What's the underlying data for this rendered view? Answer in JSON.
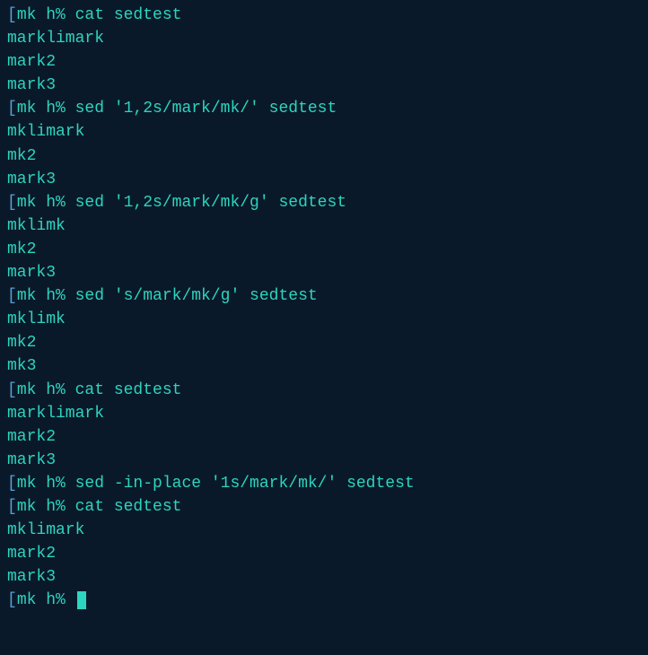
{
  "prompt_bracket": "[",
  "prompt": "mk h% ",
  "lines": [
    {
      "type": "prompt",
      "cmd": "cat sedtest"
    },
    {
      "type": "output",
      "text": "marklimark"
    },
    {
      "type": "output",
      "text": "mark2"
    },
    {
      "type": "output",
      "text": "mark3"
    },
    {
      "type": "prompt",
      "cmd": "sed '1,2s/mark/mk/' sedtest"
    },
    {
      "type": "output",
      "text": "mklimark"
    },
    {
      "type": "output",
      "text": "mk2"
    },
    {
      "type": "output",
      "text": "mark3"
    },
    {
      "type": "prompt",
      "cmd": "sed '1,2s/mark/mk/g' sedtest"
    },
    {
      "type": "output",
      "text": "mklimk"
    },
    {
      "type": "output",
      "text": "mk2"
    },
    {
      "type": "output",
      "text": "mark3"
    },
    {
      "type": "prompt",
      "cmd": "sed 's/mark/mk/g' sedtest"
    },
    {
      "type": "output",
      "text": "mklimk"
    },
    {
      "type": "output",
      "text": "mk2"
    },
    {
      "type": "output",
      "text": "mk3"
    },
    {
      "type": "prompt",
      "cmd": "cat sedtest"
    },
    {
      "type": "output",
      "text": "marklimark"
    },
    {
      "type": "output",
      "text": "mark2"
    },
    {
      "type": "output",
      "text": "mark3"
    },
    {
      "type": "prompt",
      "cmd": "sed -in-place '1s/mark/mk/' sedtest"
    },
    {
      "type": "prompt",
      "cmd": "cat sedtest"
    },
    {
      "type": "output",
      "text": "mklimark"
    },
    {
      "type": "output",
      "text": "mark2"
    },
    {
      "type": "output",
      "text": "mark3"
    },
    {
      "type": "prompt-cursor",
      "cmd": ""
    }
  ]
}
